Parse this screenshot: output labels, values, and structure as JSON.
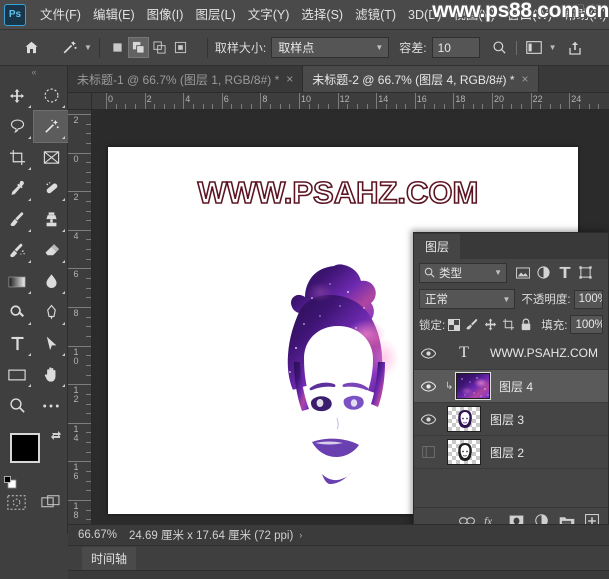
{
  "app": {
    "logo": "Ps",
    "watermark_top": "www.ps88.com.cn",
    "watermark_canvas": "WWW.PSAHZ.COM"
  },
  "menubar": {
    "items": [
      {
        "label": "文件(F)",
        "name": "menu-file"
      },
      {
        "label": "编辑(E)",
        "name": "menu-edit"
      },
      {
        "label": "图像(I)",
        "name": "menu-image"
      },
      {
        "label": "图层(L)",
        "name": "menu-layer"
      },
      {
        "label": "文字(Y)",
        "name": "menu-type"
      },
      {
        "label": "选择(S)",
        "name": "menu-select"
      },
      {
        "label": "滤镜(T)",
        "name": "menu-filter"
      },
      {
        "label": "3D(D)",
        "name": "menu-3d"
      },
      {
        "label": "视图(V)",
        "name": "menu-view"
      },
      {
        "label": "窗口(W)",
        "name": "menu-window"
      },
      {
        "label": "帮助(H)",
        "name": "menu-help"
      }
    ]
  },
  "optionsbar": {
    "sample_size_label": "取样大小:",
    "sample_size_value": "取样点",
    "tolerance_label": "容差:",
    "tolerance_value": "10"
  },
  "tabs": [
    {
      "label": "未标题-1 @ 66.7% (图层 1, RGB/8#) *",
      "close": "×",
      "active": false
    },
    {
      "label": "未标题-2 @ 66.7% (图层 4, RGB/8#) *",
      "close": "×",
      "active": true
    }
  ],
  "rulers": {
    "horizontal": [
      "0",
      "2",
      "4",
      "6",
      "8",
      "10",
      "12",
      "14",
      "16",
      "18",
      "20",
      "22",
      "24"
    ],
    "vertical": [
      "2",
      "0",
      "2",
      "4",
      "6",
      "8",
      "10",
      "12",
      "14",
      "16",
      "18"
    ]
  },
  "statusbar": {
    "zoom": "66.67%",
    "dimensions": "24.69 厘米 x 17.64 厘米 (72 ppi)",
    "expand": "›"
  },
  "timeline": {
    "tab_label": "时间轴"
  },
  "layers_panel": {
    "tab_label": "图层",
    "filter_kind_label": "类型",
    "filter_icons": [
      "image-filter-icon",
      "adjustment-filter-icon",
      "type-filter-icon",
      "shape-filter-icon"
    ],
    "blend_mode": "正常",
    "opacity_label": "不透明度:",
    "opacity_value": "100%",
    "lock_label": "锁定:",
    "fill_label": "填充:",
    "fill_value": "100%",
    "rows": [
      {
        "name": "WWW.PSAHZ.COM",
        "type": "text",
        "visible": true,
        "selected": false,
        "clipped": false
      },
      {
        "name": "图层 4",
        "type": "galaxy",
        "visible": true,
        "selected": true,
        "clipped": true
      },
      {
        "name": "图层 3",
        "type": "portrait",
        "visible": true,
        "selected": false,
        "clipped": false
      },
      {
        "name": "图层 2",
        "type": "portrait",
        "visible": false,
        "selected": false,
        "clipped": false
      }
    ],
    "footer_icons": [
      "link-icon",
      "fx-icon",
      "mask-icon",
      "adjustment-icon",
      "group-icon",
      "new-layer-icon"
    ]
  },
  "colors": {
    "foreground": "#000000",
    "background": "#ffffff",
    "panel_bg": "#454545",
    "app_bg": "#3f3f3f",
    "canvas_bg": "#2b2b2b",
    "accent": "#5fc4f0",
    "text_outline": "#5c1423"
  }
}
